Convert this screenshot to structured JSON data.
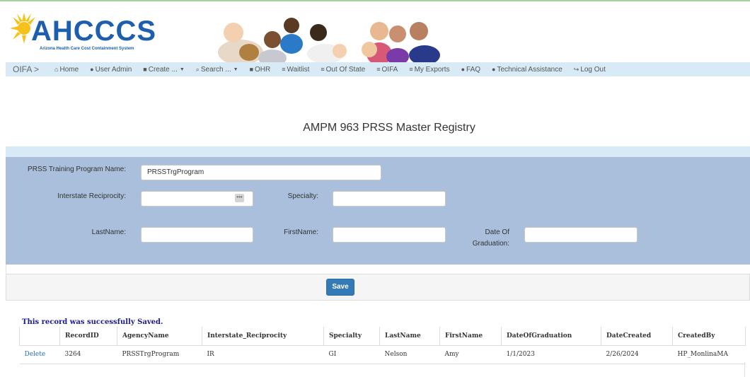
{
  "logo": {
    "name": "AHCCCS",
    "tagline": "Arizona Health Care Cost Containment System"
  },
  "nav": {
    "brand": "OIFA >",
    "items": [
      {
        "label": "Home",
        "icon": "home-icon",
        "glyph": "⌂"
      },
      {
        "label": "User Admin",
        "icon": "user-icon",
        "glyph": "●"
      },
      {
        "label": "Create ...",
        "icon": "file-icon",
        "glyph": "■",
        "dropdown": true
      },
      {
        "label": "Search ...",
        "icon": "search-icon",
        "glyph": "⌕",
        "dropdown": true
      },
      {
        "label": "OHR",
        "icon": "file-icon",
        "glyph": "■"
      },
      {
        "label": "Waitlist",
        "icon": "list-icon",
        "glyph": "≡"
      },
      {
        "label": "Out Of State",
        "icon": "list-icon",
        "glyph": "≡"
      },
      {
        "label": "OIFA",
        "icon": "list-icon",
        "glyph": "≡"
      },
      {
        "label": "My Exports",
        "icon": "list-icon",
        "glyph": "≡"
      },
      {
        "label": "FAQ",
        "icon": "question-icon",
        "glyph": "●"
      },
      {
        "label": "Technical Assistance",
        "icon": "question-icon",
        "glyph": "●"
      },
      {
        "label": "Log Out",
        "icon": "logout-icon",
        "glyph": "↪"
      }
    ]
  },
  "page": {
    "title": "AMPM 963 PRSS Master Registry"
  },
  "form": {
    "training_program_label": "PRSS Training Program Name:",
    "training_program_value": "PRSSTrgProgram",
    "reciprocity_label": "Interstate Reciprocity:",
    "reciprocity_value": "",
    "specialty_label": "Specialty:",
    "specialty_value": "",
    "lastname_label": "LastName:",
    "lastname_value": "",
    "firstname_label": "FirstName:",
    "firstname_value": "",
    "graduation_label_line1": "Date Of",
    "graduation_label_line2": "Graduation:",
    "graduation_value": "",
    "save_label": "Save"
  },
  "results": {
    "message": "This record was successfully Saved.",
    "columns": [
      "RecordID",
      "AgencyName",
      "Interstate_Reciprocity",
      "Specialty",
      "LastName",
      "FirstName",
      "DateOfGraduation",
      "DateCreated",
      "CreatedBy"
    ],
    "rows": [
      {
        "action": "Delete",
        "RecordID": "3264",
        "AgencyName": "PRSSTrgProgram",
        "Interstate_Reciprocity": "IR",
        "Specialty": "GI",
        "LastName": "Nelson",
        "FirstName": "Amy",
        "DateOfGraduation": "1/1/2023",
        "DateCreated": "2/26/2024",
        "CreatedBy": "HP_MonlinaMA"
      }
    ]
  },
  "colors": {
    "nav_bg": "#d8eaf5",
    "panel_bg": "#a9bfdc",
    "primary_button": "#337ab7",
    "link": "#2a6bbf",
    "logo_blue": "#1d5fae",
    "success_text": "#1a1a8c"
  }
}
